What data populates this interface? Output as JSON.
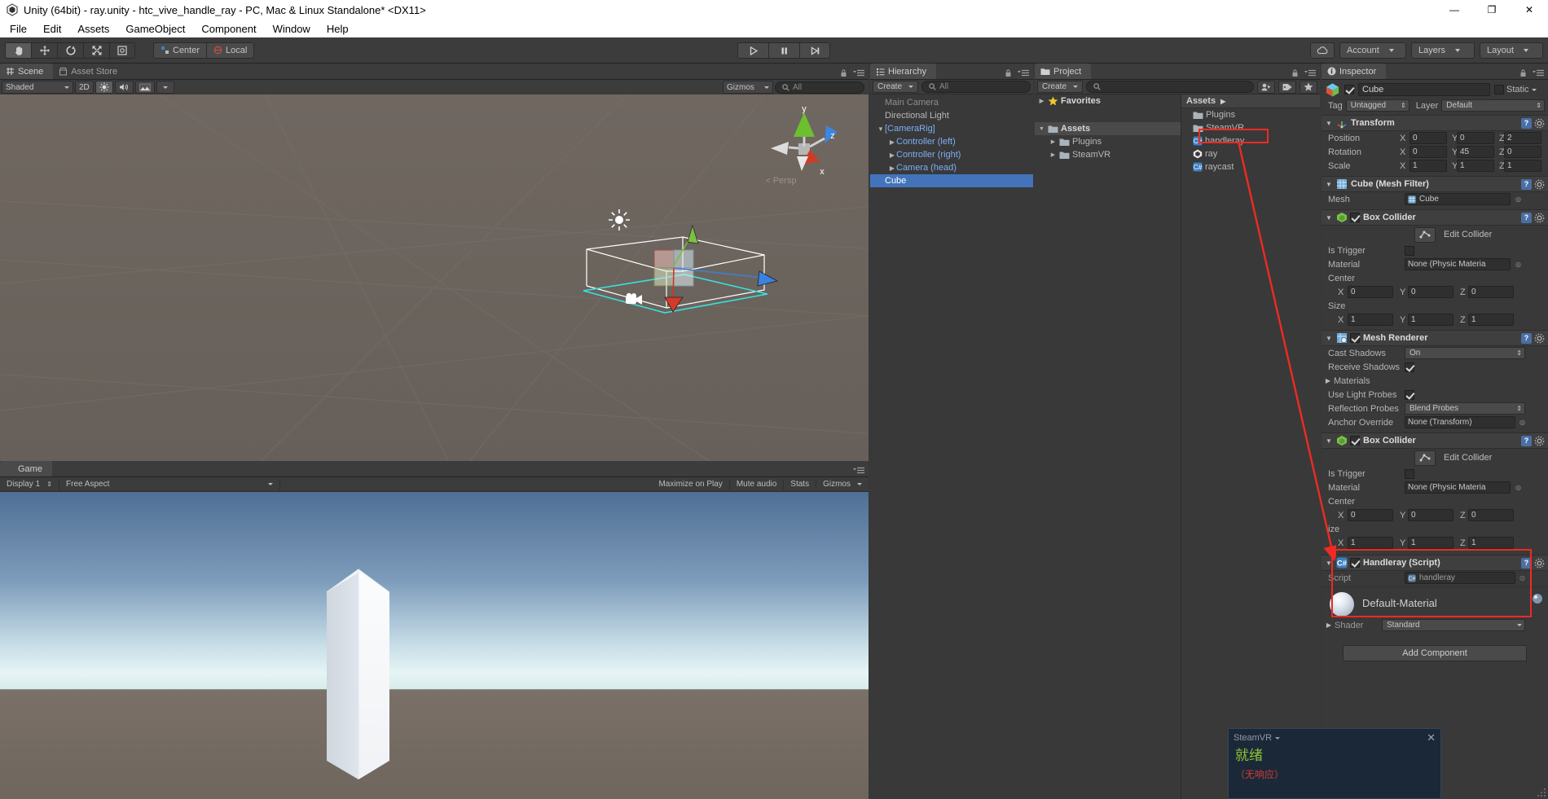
{
  "window": {
    "title": "Unity (64bit) - ray.unity - htc_vive_handle_ray - PC, Mac & Linux Standalone* <DX11>",
    "app_icon": "unity-icon",
    "minimize": "—",
    "restore": "❐",
    "close": "✕"
  },
  "menubar": {
    "items": [
      {
        "label": "File"
      },
      {
        "label": "Edit"
      },
      {
        "label": "Assets"
      },
      {
        "label": "GameObject"
      },
      {
        "label": "Component"
      },
      {
        "label": "Window"
      },
      {
        "label": "Help"
      }
    ]
  },
  "toolbar": {
    "transform_tools": [
      {
        "name": "hand-tool",
        "active": true
      },
      {
        "name": "move-tool",
        "active": false
      },
      {
        "name": "rotate-tool",
        "active": false
      },
      {
        "name": "scale-tool",
        "active": false
      },
      {
        "name": "rect-tool",
        "active": false
      }
    ],
    "pivot_label": "Center",
    "space_label": "Local",
    "play": "play-icon",
    "pause": "pause-icon",
    "step": "step-icon",
    "cloud_label": "cloud-icon",
    "account_label": "Account",
    "layers_label": "Layers",
    "layout_label": "Layout"
  },
  "scene": {
    "tabs": [
      {
        "label": "Scene",
        "icon": "scene-grid-icon",
        "active": true
      },
      {
        "label": "Asset Store",
        "icon": "store-icon",
        "active": false
      }
    ],
    "draw_mode": "Shaded",
    "mode_2d": "2D",
    "lighting_toggle": "light-icon",
    "audio_toggle": "audio-icon",
    "fx_toggle": "fx-icon",
    "gizmos_label": "Gizmos",
    "search_placeholder": "All",
    "persp_label": "Persp",
    "axis_x": "x",
    "axis_y": "y",
    "axis_z": "z"
  },
  "game": {
    "tab_label": "Game",
    "display": "Display 1",
    "aspect": "Free Aspect",
    "maximize_on_play": "Maximize on Play",
    "mute_audio": "Mute audio",
    "stats": "Stats",
    "gizmos": "Gizmos"
  },
  "hierarchy": {
    "tab_label": "Hierarchy",
    "create_label": "Create",
    "search_placeholder": "All",
    "items": [
      {
        "label": "Main Camera",
        "depth": 0,
        "arrow": "",
        "style": "dim",
        "selected": false
      },
      {
        "label": "Directional Light",
        "depth": 0,
        "arrow": "",
        "style": "normal",
        "selected": false
      },
      {
        "label": "[CameraRig]",
        "depth": 0,
        "arrow": "down",
        "style": "prefab",
        "selected": false
      },
      {
        "label": "Controller (left)",
        "depth": 1,
        "arrow": "right",
        "style": "prefab",
        "selected": false
      },
      {
        "label": "Controller (right)",
        "depth": 1,
        "arrow": "right",
        "style": "prefab",
        "selected": false
      },
      {
        "label": "Camera (head)",
        "depth": 1,
        "arrow": "right",
        "style": "prefab",
        "selected": false
      },
      {
        "label": "Cube",
        "depth": 0,
        "arrow": "",
        "style": "normal",
        "selected": true
      }
    ]
  },
  "project": {
    "tab_label": "Project",
    "create_label": "Create",
    "search_placeholder": "",
    "tree": [
      {
        "label": "Favorites",
        "arrow": "right",
        "icon": "star-icon",
        "depth": 0,
        "bold": true
      },
      {
        "label": "",
        "arrow": "",
        "icon": "",
        "depth": 0,
        "bold": false
      },
      {
        "label": "Assets",
        "arrow": "down",
        "icon": "folder-icon",
        "depth": 0,
        "bold": true,
        "selected": true
      },
      {
        "label": "Plugins",
        "arrow": "right",
        "icon": "folder-icon",
        "depth": 1,
        "bold": false
      },
      {
        "label": "SteamVR",
        "arrow": "right",
        "icon": "folder-icon",
        "depth": 1,
        "bold": false
      }
    ],
    "breadcrumb": "Assets",
    "assets": [
      {
        "label": "Plugins",
        "icon": "folder-icon",
        "highlighted": false
      },
      {
        "label": "SteamVR",
        "icon": "folder-icon",
        "highlighted": false
      },
      {
        "label": "handleray",
        "icon": "csharp-script-icon",
        "highlighted": true
      },
      {
        "label": "ray",
        "icon": "unity-scene-icon",
        "highlighted": false
      },
      {
        "label": "raycast",
        "icon": "csharp-script-icon",
        "highlighted": false
      }
    ]
  },
  "inspector": {
    "tab_label": "Inspector",
    "object_name": "Cube",
    "enabled": true,
    "static_label": "Static",
    "tag_label": "Tag",
    "tag_value": "Untagged",
    "layer_label": "Layer",
    "layer_value": "Default",
    "components": [
      {
        "title": "Transform",
        "icon": "transform-icon",
        "has_checkbox": false,
        "rows": [
          {
            "type": "vec3",
            "label": "Position",
            "x": "0",
            "y": "0",
            "z": "2"
          },
          {
            "type": "vec3",
            "label": "Rotation",
            "x": "0",
            "y": "45",
            "z": "0"
          },
          {
            "type": "vec3",
            "label": "Scale",
            "x": "1",
            "y": "1",
            "z": "1"
          }
        ]
      },
      {
        "title": "Cube (Mesh Filter)",
        "icon": "meshfilter-icon",
        "has_checkbox": false,
        "rows": [
          {
            "type": "object",
            "label": "Mesh",
            "value": "Cube"
          }
        ]
      },
      {
        "title": "Box Collider",
        "icon": "collider-icon",
        "has_checkbox": true,
        "checked": true,
        "rows": [
          {
            "type": "editbtn",
            "label": "Edit Collider"
          },
          {
            "type": "checkbox",
            "label": "Is Trigger",
            "checked": false
          },
          {
            "type": "object",
            "label": "Material",
            "value": "None (Physic Materia"
          },
          {
            "type": "grouplabel",
            "label": "Center"
          },
          {
            "type": "vec3indent",
            "x": "0",
            "y": "0",
            "z": "0"
          },
          {
            "type": "grouplabel",
            "label": "Size"
          },
          {
            "type": "vec3indent",
            "x": "1",
            "y": "1",
            "z": "1"
          }
        ]
      },
      {
        "title": "Mesh Renderer",
        "icon": "meshrenderer-icon",
        "has_checkbox": true,
        "checked": true,
        "rows": [
          {
            "type": "popup",
            "label": "Cast Shadows",
            "value": "On"
          },
          {
            "type": "checkbox",
            "label": "Receive Shadows",
            "checked": true
          },
          {
            "type": "foldoutlabel",
            "label": "Materials"
          },
          {
            "type": "checkbox",
            "label": "Use Light Probes",
            "checked": true
          },
          {
            "type": "popup",
            "label": "Reflection Probes",
            "value": "Blend Probes"
          },
          {
            "type": "object",
            "label": "Anchor Override",
            "value": "None (Transform)"
          }
        ]
      },
      {
        "title": "Box Collider",
        "icon": "collider-icon",
        "has_checkbox": true,
        "checked": true,
        "rows": [
          {
            "type": "editbtn",
            "label": "Edit Collider"
          },
          {
            "type": "checkbox",
            "label": "Is Trigger",
            "checked": false
          },
          {
            "type": "object",
            "label": "Material",
            "value": "None (Physic Materia"
          },
          {
            "type": "grouplabel",
            "label": "Center"
          },
          {
            "type": "vec3indent",
            "x": "0",
            "y": "0",
            "z": "0"
          },
          {
            "type": "grouplabel",
            "label": "ize"
          },
          {
            "type": "vec3indent",
            "x": "1",
            "y": "1",
            "z": "1"
          }
        ]
      },
      {
        "title": "Handleray (Script)",
        "icon": "csharp-script-icon",
        "has_checkbox": true,
        "checked": true,
        "rows": [
          {
            "type": "object",
            "label": "Script",
            "value": "handleray"
          }
        ]
      }
    ],
    "material_preview": {
      "name": "Default-Material",
      "shader_label": "Shader",
      "shader_value": "Standard"
    },
    "add_component_label": "Add Component"
  },
  "steamvr": {
    "title": "SteamVR",
    "close": "✕",
    "status": "就绪",
    "not_responding": "（无响应）"
  },
  "colors": {
    "accent_selection": "#4374bb",
    "prefab_blue": "#7daef5",
    "panel_bg": "#393939",
    "toolbar_bg": "#3c3c3c",
    "annotation_red": "#ee2a24",
    "ready_green": "#8ec436",
    "error_red": "#d33b35"
  }
}
